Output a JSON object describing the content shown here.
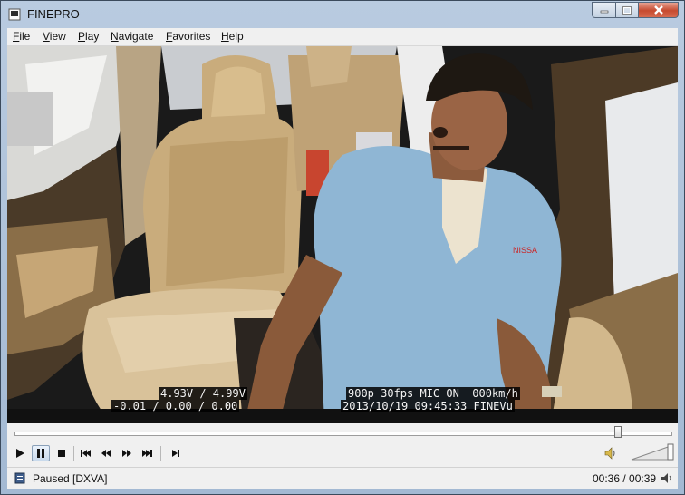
{
  "window": {
    "title": "FINEPRO"
  },
  "menu": [
    {
      "label": "File"
    },
    {
      "label": "View"
    },
    {
      "label": "Play"
    },
    {
      "label": "Navigate"
    },
    {
      "label": "Favorites"
    },
    {
      "label": "Help"
    }
  ],
  "overlay": {
    "voltage": "4.93V / 4.99V",
    "gsensor": "-0.01 / 0.00 / 0.00",
    "recording_info": "900p 30fps MIC ON  000km/h",
    "timestamp": "2013/10/19 09:45:33 FINEVu"
  },
  "video_content": {
    "shirt_logo": "NISSA"
  },
  "playback": {
    "position_fraction": 0.92,
    "volume_fraction": 1.0,
    "state": "paused"
  },
  "status": {
    "text": "Paused [DXVA]",
    "time": "00:36 / 00:39"
  },
  "icons": [
    "app-icon",
    "minimize-icon",
    "maximize-icon",
    "close-icon",
    "play-icon",
    "pause-icon",
    "stop-icon",
    "skip-back-icon",
    "step-back-icon",
    "step-forward-icon",
    "skip-forward-icon",
    "frame-step-icon",
    "speaker-icon",
    "status-icon",
    "audio-status-icon"
  ]
}
